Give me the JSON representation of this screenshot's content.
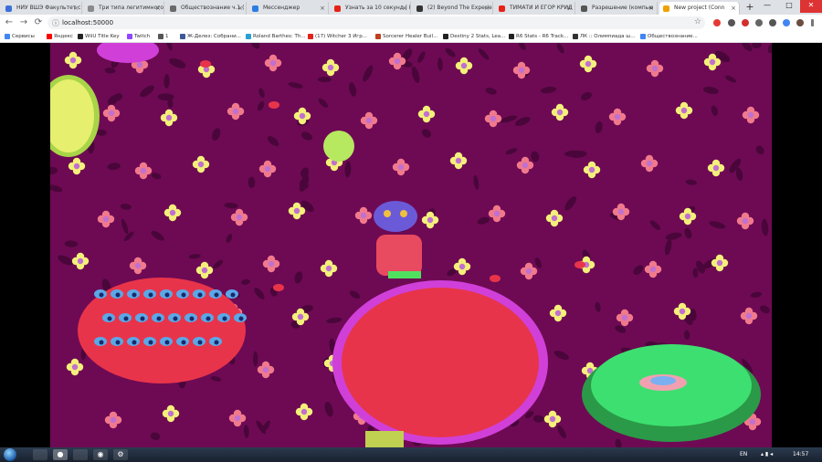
{
  "browser": {
    "tabs": [
      {
        "label": "НИУ ВШЭ Факультет с",
        "color": "#3a6fd8"
      },
      {
        "label": "Три типа легитимного",
        "color": "#8a8a8a"
      },
      {
        "label": "Обществознание ч.1 (",
        "color": "#6a6a6a"
      },
      {
        "label": "Мессенджер",
        "color": "#2a7de1"
      },
      {
        "label": "Узнать за 10 секунд | К",
        "color": "#e62117"
      },
      {
        "label": "(2) Beyond The Experie",
        "color": "#333333"
      },
      {
        "label": "ТИМАТИ И ЕГОР КРИД",
        "color": "#e62117"
      },
      {
        "label": "Разрешение (компью",
        "color": "#555555"
      },
      {
        "label": "New project (Conn",
        "color": "#f0a000"
      }
    ],
    "new_tab_glyph": "+",
    "window_controls": {
      "minimize": "—",
      "maximize": "□",
      "close": "✕"
    },
    "address": {
      "url": "localhost:50000",
      "lock_glyph": "ⓘ",
      "star_glyph": "☆"
    },
    "nav": {
      "back": "←",
      "forward": "→",
      "reload": "⟳"
    },
    "bookmarks": [
      {
        "label": "Сервисы",
        "color": "#4285f4"
      },
      {
        "label": "Яндекс",
        "color": "#ff0000"
      },
      {
        "label": "WiiU Title Key",
        "color": "#222222"
      },
      {
        "label": "Twitch",
        "color": "#9146ff"
      },
      {
        "label": "1",
        "color": "#555555"
      },
      {
        "label": "Ж-Делез: Собрани...",
        "color": "#3b5998"
      },
      {
        "label": "Roland Barthes: Th...",
        "color": "#2a9fd6"
      },
      {
        "label": "(17) Witcher 3 Игр...",
        "color": "#e62117"
      },
      {
        "label": "Sorcerer Healer Buil...",
        "color": "#c04020"
      },
      {
        "label": "Destiny 2 Stats, Lea...",
        "color": "#222222"
      },
      {
        "label": "R6 Stats - R6 Track...",
        "color": "#222222"
      },
      {
        "label": "ЛК :: Олимпиада ш...",
        "color": "#333333"
      },
      {
        "label": "Обществознание...",
        "color": "#4285f4"
      }
    ]
  },
  "taskbar": {
    "language": "EN",
    "time": "14:57",
    "apps": [
      "chrome",
      "steam",
      "settings"
    ]
  },
  "colors": {
    "background": "#6e0a54",
    "blob": "#4a063a",
    "flower_pink": "#f07a8c",
    "flower_yellow": "#f4f07a",
    "center_purple": "#c070d0",
    "red_bush": "#e8344a",
    "magenta_rim": "#d040d8",
    "green_plant": "#3de070",
    "character_head": "#6b5ad8",
    "character_body": "#e84a60"
  }
}
